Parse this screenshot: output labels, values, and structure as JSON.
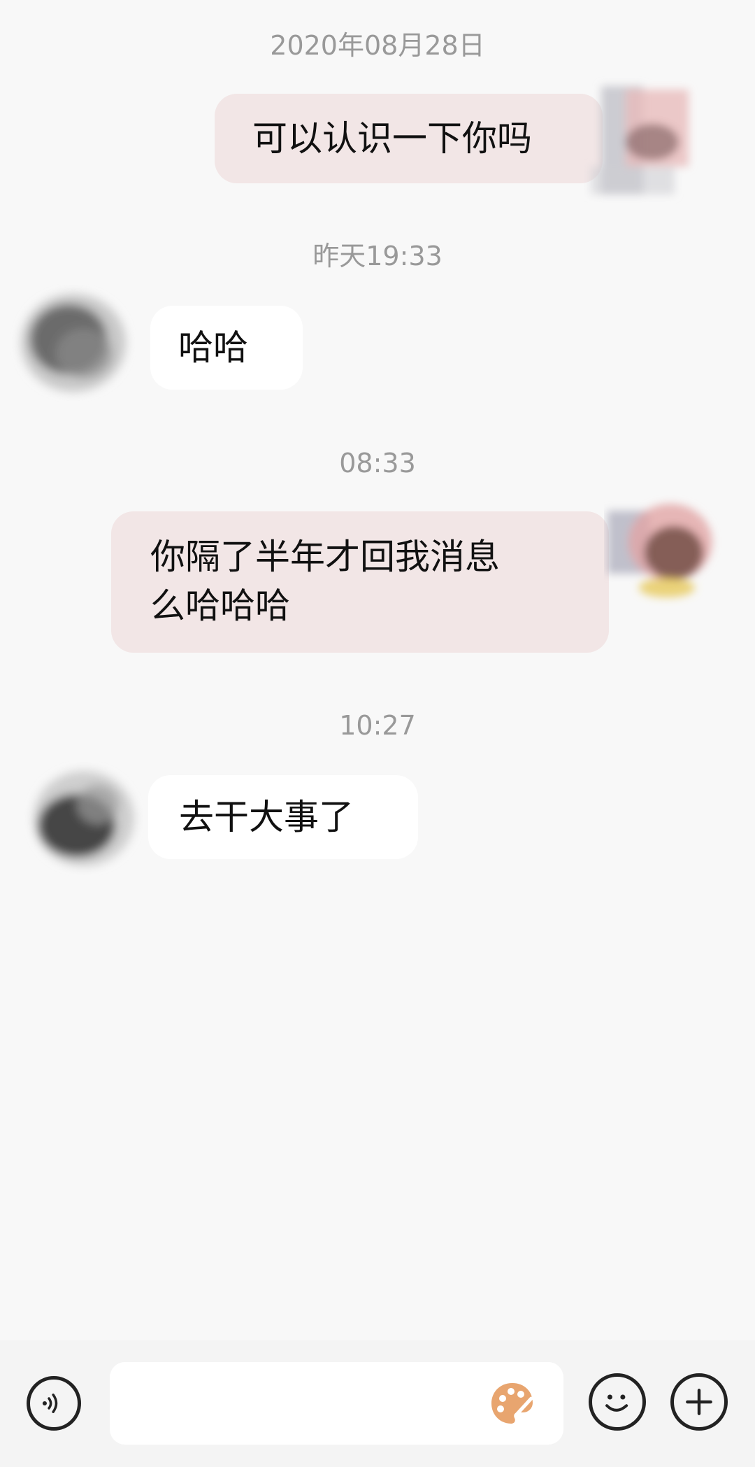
{
  "messages": [
    {
      "timestamp": "2020年08月28日",
      "direction": "outgoing",
      "text": "可以认识一下你吗"
    },
    {
      "timestamp": "昨天19:33",
      "direction": "incoming",
      "text": "哈哈"
    },
    {
      "timestamp": "08:33",
      "direction": "outgoing",
      "text": "你隔了半年才回我消息\n么哈哈哈"
    },
    {
      "timestamp": "10:27",
      "direction": "incoming",
      "text": "去干大事了"
    }
  ],
  "input_bar": {
    "voice_icon": "voice-icon",
    "message_value": "",
    "palette_icon": "palette-icon",
    "emoji_icon": "emoji-icon",
    "plus_icon": "plus-icon"
  },
  "colors": {
    "background": "#f8f8f8",
    "outgoing_bubble": "#f2e6e6",
    "incoming_bubble": "#ffffff",
    "timestamp_text": "#999999",
    "palette_accent": "#e8a56f"
  }
}
